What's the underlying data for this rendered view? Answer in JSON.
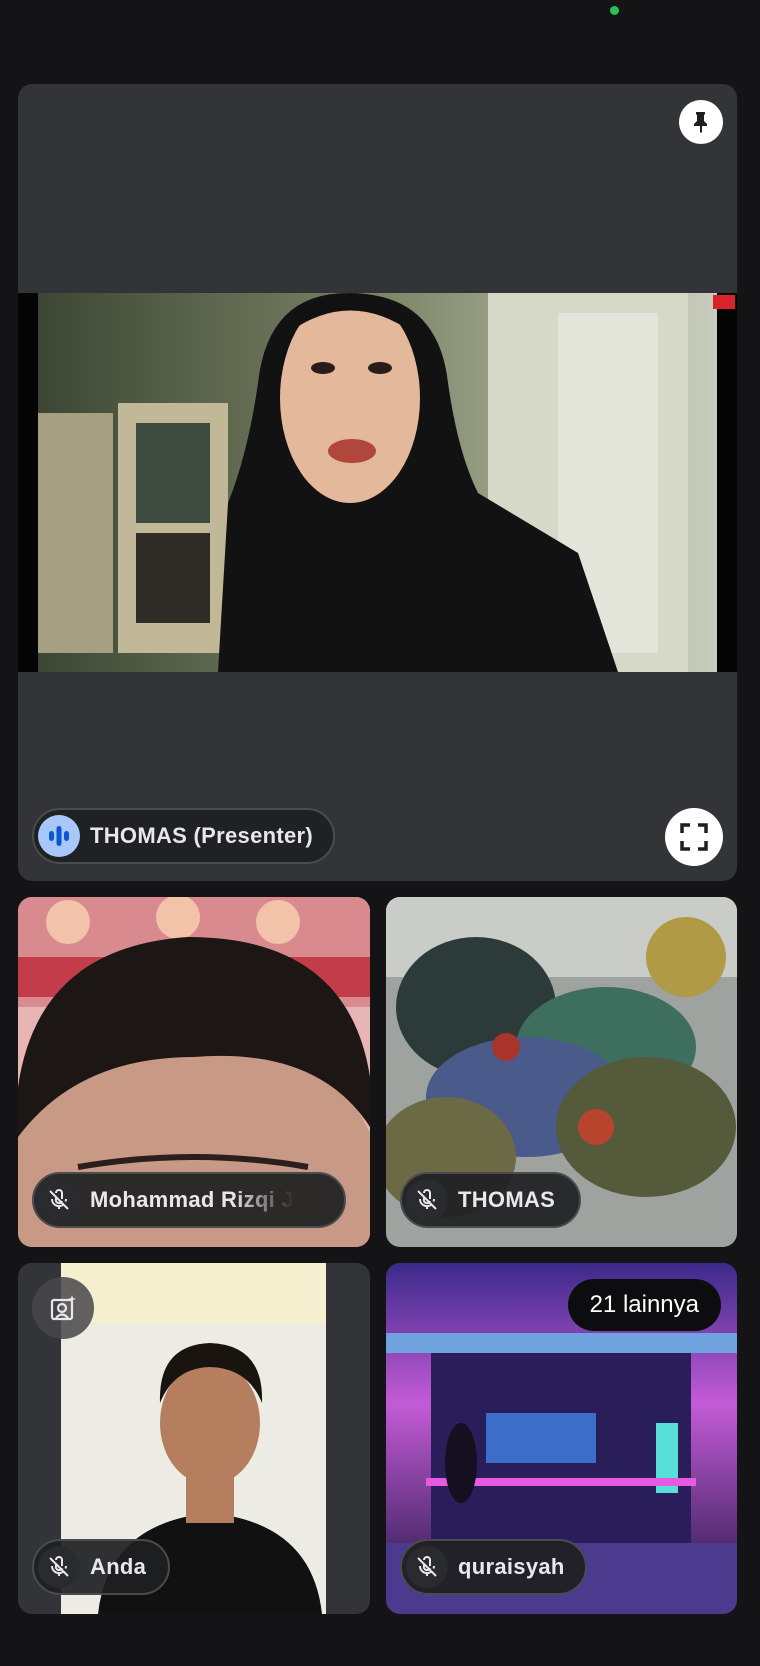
{
  "main_tile": {
    "presenter_label": "THOMAS (Presenter)"
  },
  "participants": [
    {
      "name": "Mohammad Rizqi J",
      "muted": true
    },
    {
      "name": "THOMAS",
      "muted": true
    },
    {
      "name": "Anda",
      "muted": true
    },
    {
      "name": "quraisyah",
      "muted": true
    }
  ],
  "more_participants_label": "21 lainnya",
  "icons": {
    "pin": "pin-icon",
    "fullscreen": "fullscreen-icon",
    "speaking": "audio-level-icon",
    "mic_off": "mic-off-icon",
    "camera_effects": "camera-effects-icon"
  },
  "colors": {
    "background": "#141416",
    "tile": "#333437",
    "speaking_badge": "#a8c7fa",
    "status_dot": "#25c05a"
  }
}
